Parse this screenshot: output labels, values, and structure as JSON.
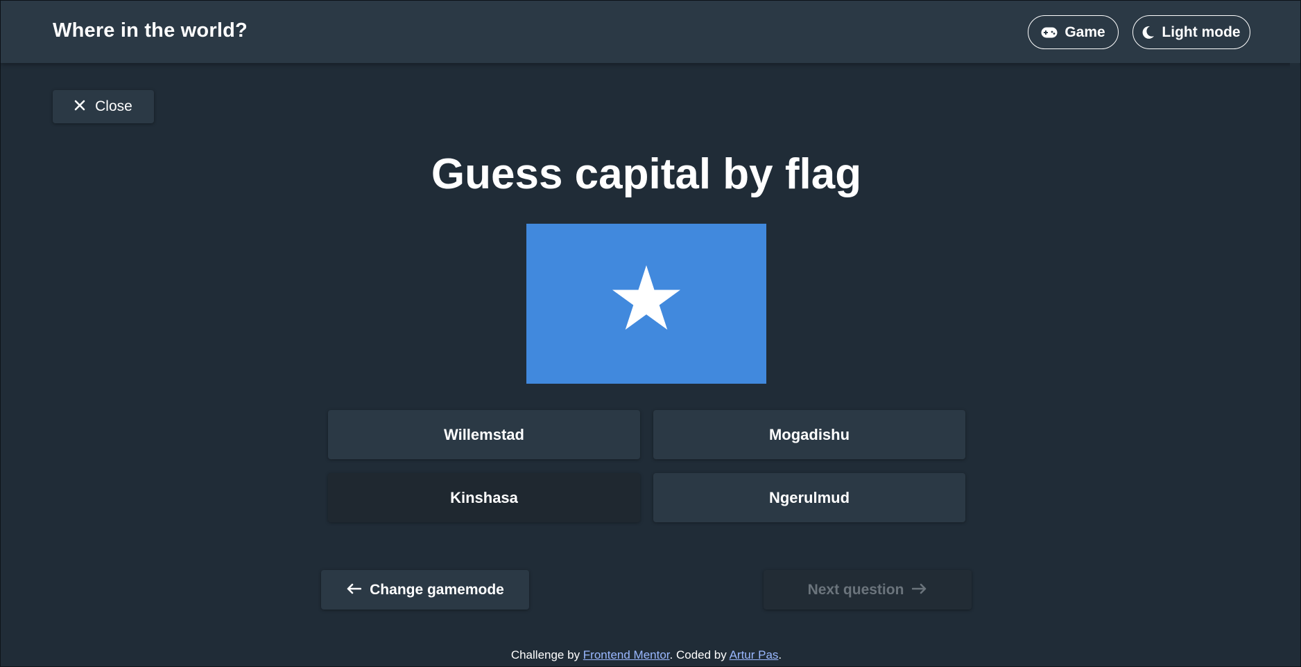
{
  "header": {
    "title": "Where in the world?",
    "game_label": "Game",
    "theme_label": "Light mode"
  },
  "close_label": "Close",
  "page_title": "Guess capital by flag",
  "flag": {
    "icon": "flag-somalia-icon",
    "background_color": "#4189dd",
    "star_color": "#ffffff"
  },
  "answers": [
    {
      "label": "Willemstad"
    },
    {
      "label": "Mogadishu"
    },
    {
      "label": "Kinshasa"
    },
    {
      "label": "Ngerulmud"
    }
  ],
  "nav": {
    "change_label": "Change gamemode",
    "next_label": "Next question"
  },
  "footer": {
    "prefix": "Challenge by ",
    "link1": "Frontend Mentor",
    "middle": ". Coded by ",
    "link2": "Artur Pas",
    "suffix": "."
  },
  "colors": {
    "background": "#202c37",
    "surface": "#2b3945",
    "link": "#9ab8ff"
  }
}
